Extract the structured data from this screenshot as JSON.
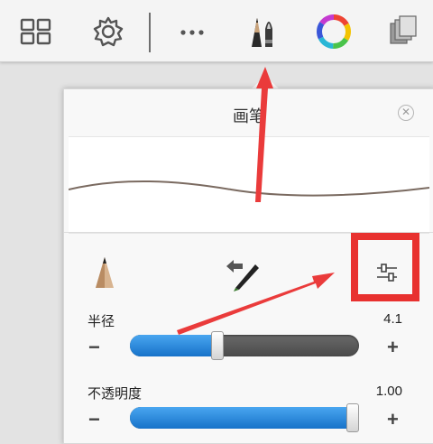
{
  "toolbar": {
    "items": [
      {
        "icon": "grid-icon"
      },
      {
        "icon": "gear-icon"
      },
      {
        "icon": "more-icon"
      },
      {
        "icon": "brushes-icon"
      },
      {
        "icon": "color-wheel-icon"
      },
      {
        "icon": "layers-icon"
      }
    ]
  },
  "panel": {
    "title": "画笔",
    "tools": [
      "pencil-icon",
      "brush-swap-icon",
      "sliders-icon"
    ],
    "sliders": [
      {
        "label": "半径",
        "value": "4.1",
        "level": 0.38,
        "minus": "−",
        "plus": "+"
      },
      {
        "label": "不透明度",
        "value": "1.00",
        "level": 1.0,
        "minus": "−",
        "plus": "+"
      }
    ]
  },
  "annotations": {
    "highlight_color": "#e8312f",
    "arrow_color": "#ea3b3b"
  }
}
